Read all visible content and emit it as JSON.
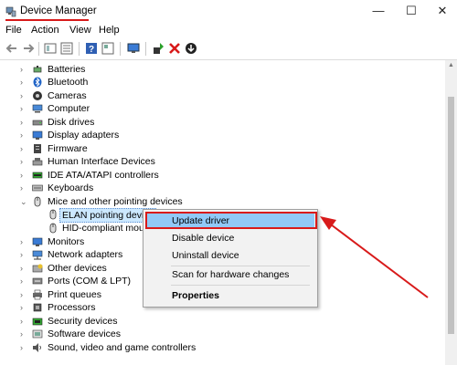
{
  "window": {
    "title": "Device Manager",
    "controls": {
      "minimize": "—",
      "maximize": "☐",
      "close": "✕"
    }
  },
  "menu": [
    "File",
    "Action",
    "View",
    "Help"
  ],
  "toolbar": {
    "icons": [
      "back-icon",
      "forward-icon",
      "properties-view-icon",
      "show-hidden-icon",
      "help-icon",
      "view-by-icon",
      "monitor-icon",
      "update-driver-icon",
      "uninstall-icon",
      "scan-icon"
    ]
  },
  "tree": {
    "categories": [
      {
        "label": "Batteries",
        "icon": "battery-icon",
        "expanded": false
      },
      {
        "label": "Bluetooth",
        "icon": "bluetooth-icon",
        "expanded": false
      },
      {
        "label": "Cameras",
        "icon": "camera-icon",
        "expanded": false
      },
      {
        "label": "Computer",
        "icon": "computer-icon",
        "expanded": false
      },
      {
        "label": "Disk drives",
        "icon": "disk-icon",
        "expanded": false
      },
      {
        "label": "Display adapters",
        "icon": "display-adapter-icon",
        "expanded": false
      },
      {
        "label": "Firmware",
        "icon": "firmware-icon",
        "expanded": false
      },
      {
        "label": "Human Interface Devices",
        "icon": "hid-icon",
        "expanded": false
      },
      {
        "label": "IDE ATA/ATAPI controllers",
        "icon": "ide-icon",
        "expanded": false
      },
      {
        "label": "Keyboards",
        "icon": "keyboard-icon",
        "expanded": false
      },
      {
        "label": "Mice and other pointing devices",
        "icon": "mouse-icon",
        "expanded": true
      },
      {
        "label": "Monitors",
        "icon": "monitor-icon",
        "expanded": false
      },
      {
        "label": "Network adapters",
        "icon": "network-icon",
        "expanded": false
      },
      {
        "label": "Other devices",
        "icon": "other-devices-icon",
        "expanded": false
      },
      {
        "label": "Ports (COM & LPT)",
        "icon": "port-icon",
        "expanded": false
      },
      {
        "label": "Print queues",
        "icon": "printer-icon",
        "expanded": false
      },
      {
        "label": "Processors",
        "icon": "processor-icon",
        "expanded": false
      },
      {
        "label": "Security devices",
        "icon": "security-icon",
        "expanded": false
      },
      {
        "label": "Software devices",
        "icon": "software-icon",
        "expanded": false
      },
      {
        "label": "Sound, video and game controllers",
        "icon": "sound-icon",
        "expanded": false
      }
    ],
    "mice_children": [
      {
        "label": "ELAN pointing device",
        "selected": true
      },
      {
        "label": "HID-compliant mouse",
        "selected": false
      }
    ]
  },
  "context_menu": {
    "items": [
      {
        "label": "Update driver",
        "highlighted": true
      },
      {
        "label": "Disable device"
      },
      {
        "label": "Uninstall device"
      },
      {
        "label": "Scan for hardware changes"
      },
      {
        "label": "Properties",
        "bold": true
      }
    ]
  },
  "colors": {
    "annotation_red": "#d81a1a",
    "menu_highlight": "#91c9f7",
    "selection": "#cce8ff"
  }
}
